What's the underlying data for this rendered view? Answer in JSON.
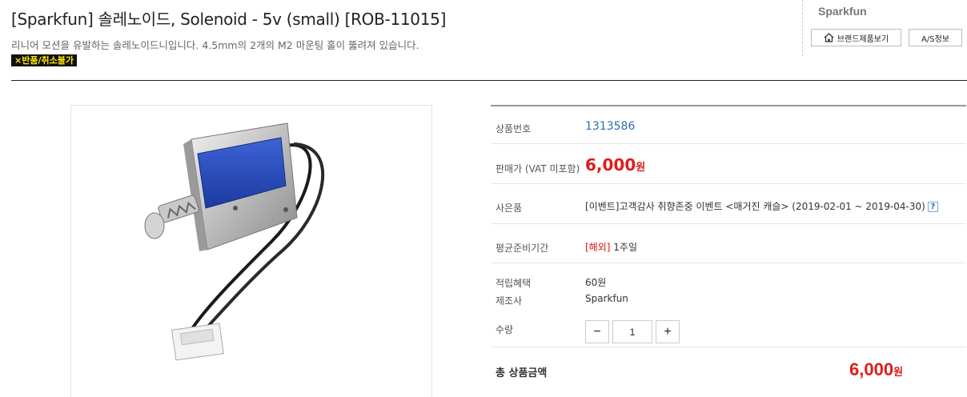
{
  "product": {
    "title": "[Sparkfun] 솔레노이드, Solenoid - 5v (small) [ROB-11015]",
    "subtitle": "리니어 모션을 유발하는 솔레노이드니입니다. 4.5mm의 2개의 M2 마운팅 홀이 뚫려져 있습니다.",
    "notice_badge": "×반품/취소불가"
  },
  "brand": {
    "name": "Sparkfun",
    "view_products_label": "브랜드제품보기",
    "as_info_label": "A/S정보",
    "home_icon": "home-icon"
  },
  "info": {
    "product_no_label": "상품번호",
    "product_no": "1313586",
    "price_label": "판매가 (VAT 미포함)",
    "price": "6,000",
    "price_unit": "원",
    "gift_label": "사은품",
    "gift_text": "[이벤트]고객감사 취향존중 이벤트 <매거진 캐슬> (2019-02-01 ~ 2019-04-30)",
    "gift_help": "?",
    "lead_time_label": "평균준비기간",
    "lead_time_tag": "[해외]",
    "lead_time_value": "1주일",
    "points_label": "적립혜택",
    "points_value": "60원",
    "maker_label": "제조사",
    "maker_value": "Sparkfun",
    "qty_label": "수량",
    "qty_minus": "−",
    "qty_value": "1",
    "qty_plus": "+",
    "total_label": "총 상품금액",
    "total_value": "6,000",
    "total_unit": "원"
  },
  "colors": {
    "price_red": "#e11b1b",
    "link_blue": "#2a6fb5",
    "badge_yellow": "#ffe600"
  }
}
